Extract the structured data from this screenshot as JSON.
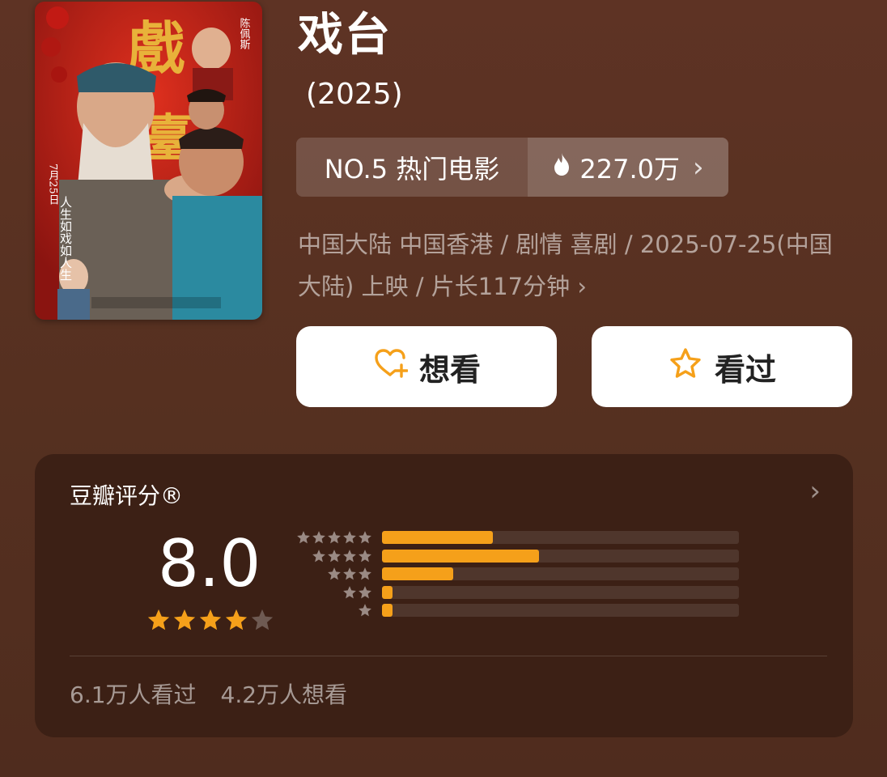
{
  "movie": {
    "title": "戏台",
    "year": "(2025)",
    "poster_name": "戏臺 movie poster"
  },
  "rank": {
    "label": "NO.5 热门电影",
    "heat": "227.0万"
  },
  "meta": {
    "line": "中国大陆 中国香港 / 剧情 喜剧 / 2025-07-25(中国大陆) 上映 / 片长117分钟"
  },
  "actions": {
    "want_label": "想看",
    "seen_label": "看过"
  },
  "rating": {
    "title": "豆瓣评分®",
    "score": "8.0",
    "stars": 4,
    "distribution": [
      {
        "stars": 5,
        "fraction": 0.31
      },
      {
        "stars": 4,
        "fraction": 0.44
      },
      {
        "stars": 3,
        "fraction": 0.2
      },
      {
        "stars": 2,
        "fraction": 0.03
      },
      {
        "stars": 1,
        "fraction": 0.03
      }
    ],
    "seen_count": "6.1万人看过",
    "want_count": "4.2万人想看"
  },
  "colors": {
    "accent": "#f5a01a",
    "background": "#5a3020",
    "card": "#3c2015"
  }
}
